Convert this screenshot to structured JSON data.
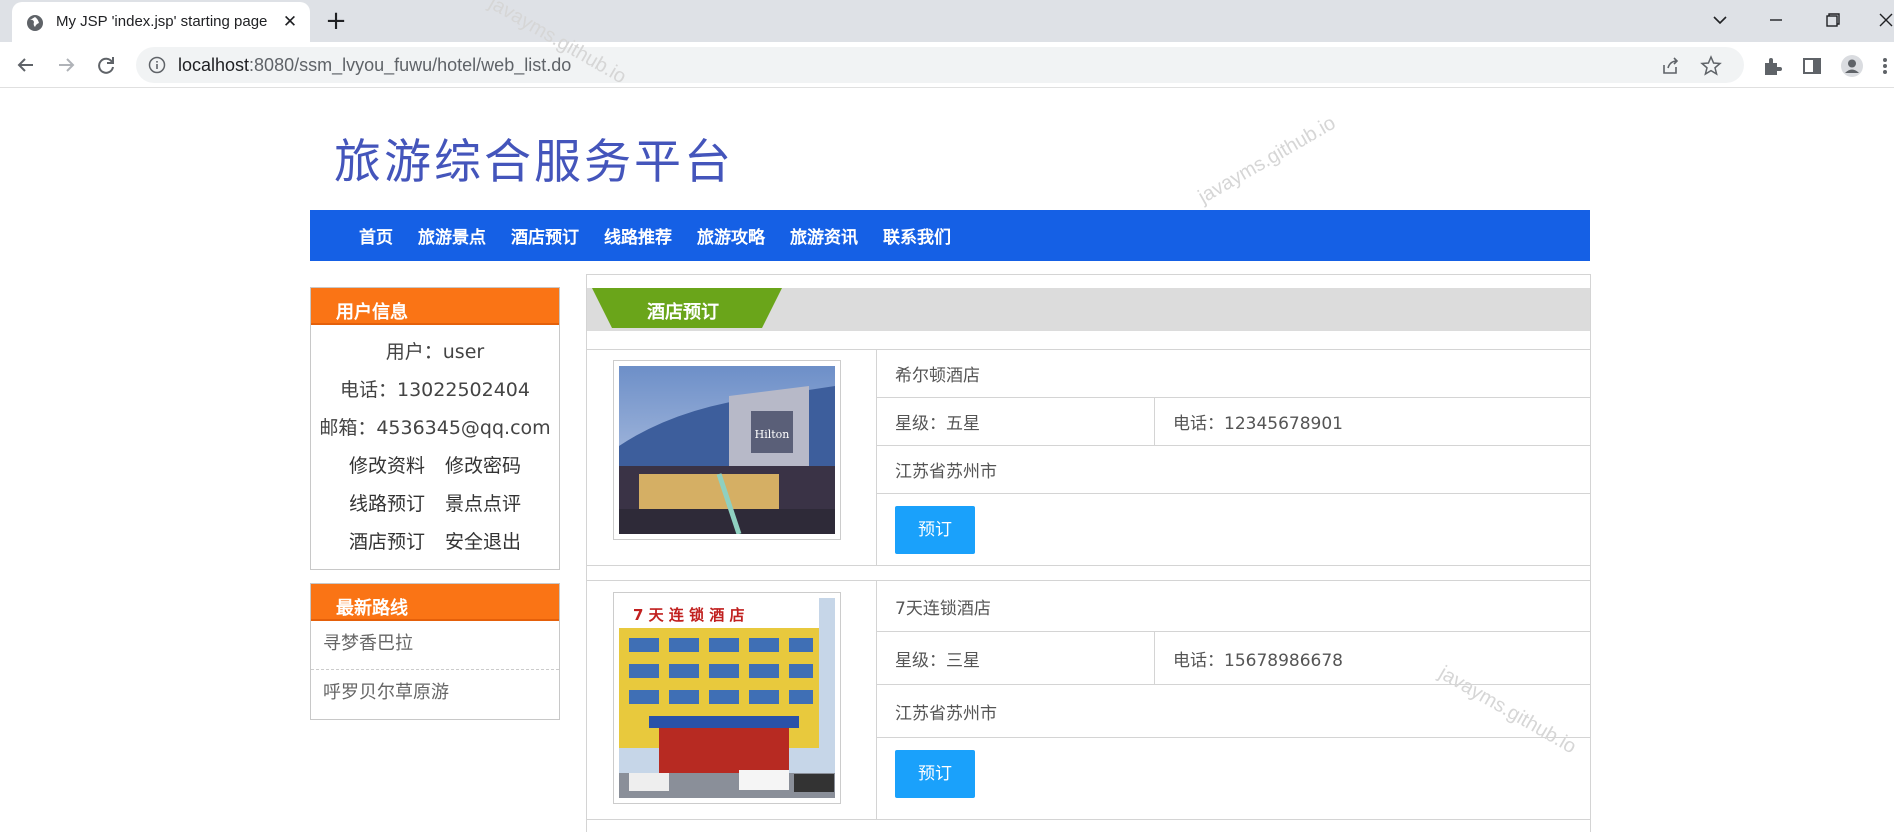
{
  "browser": {
    "tab_title": "My JSP 'index.jsp' starting page",
    "tab_close": "✕",
    "new_tab": "+",
    "url_host": "localhost",
    "url_path": ":8080/ssm_lvyou_fuwu/hotel/web_list.do",
    "icons": [
      "globe-icon",
      "back-icon",
      "forward-icon",
      "reload-icon",
      "info-icon",
      "share-icon",
      "star-icon",
      "extensions-icon",
      "side-panel-icon",
      "profile-icon",
      "menu-icon",
      "chevron-down-icon",
      "minimize-icon",
      "restore-icon",
      "close-icon"
    ]
  },
  "site": {
    "logo": "旅游综合服务平台",
    "nav": [
      "首页",
      "旅游景点",
      "酒店预订",
      "线路推荐",
      "旅游攻略",
      "旅游资讯",
      "联系我们"
    ]
  },
  "sidebar": {
    "user_title": "用户信息",
    "user_line": "用户：user",
    "phone_line": "电话：13022502404",
    "email_line": "邮箱：4536345@qq.com",
    "links": [
      [
        "修改资料",
        "修改密码"
      ],
      [
        "线路预订",
        "景点点评"
      ],
      [
        "酒店预订",
        "安全退出"
      ]
    ],
    "routes_title": "最新路线",
    "routes": [
      "寻梦香巴拉",
      "呼罗贝尔草原游"
    ]
  },
  "content": {
    "title": "酒店预订",
    "hotels": [
      {
        "name": "希尔顿酒店",
        "star": "星级：五星",
        "phone": "电话：12345678901",
        "address": "江苏省苏州市",
        "button": "预订",
        "sign_text": "Hilton"
      },
      {
        "name": "7天连锁酒店",
        "star": "星级：三星",
        "phone": "电话：15678986678",
        "address": "江苏省苏州市",
        "button": "预订",
        "sign_text": "7 天 连 锁 酒 店"
      }
    ]
  },
  "watermark": "javayms.github.io",
  "colors": {
    "nav_blue": "#1560e5",
    "orange": "#fa7415",
    "green_tab": "#6aa51a",
    "button_blue": "#1aa1fb",
    "logo_blue": "#4455bb"
  }
}
